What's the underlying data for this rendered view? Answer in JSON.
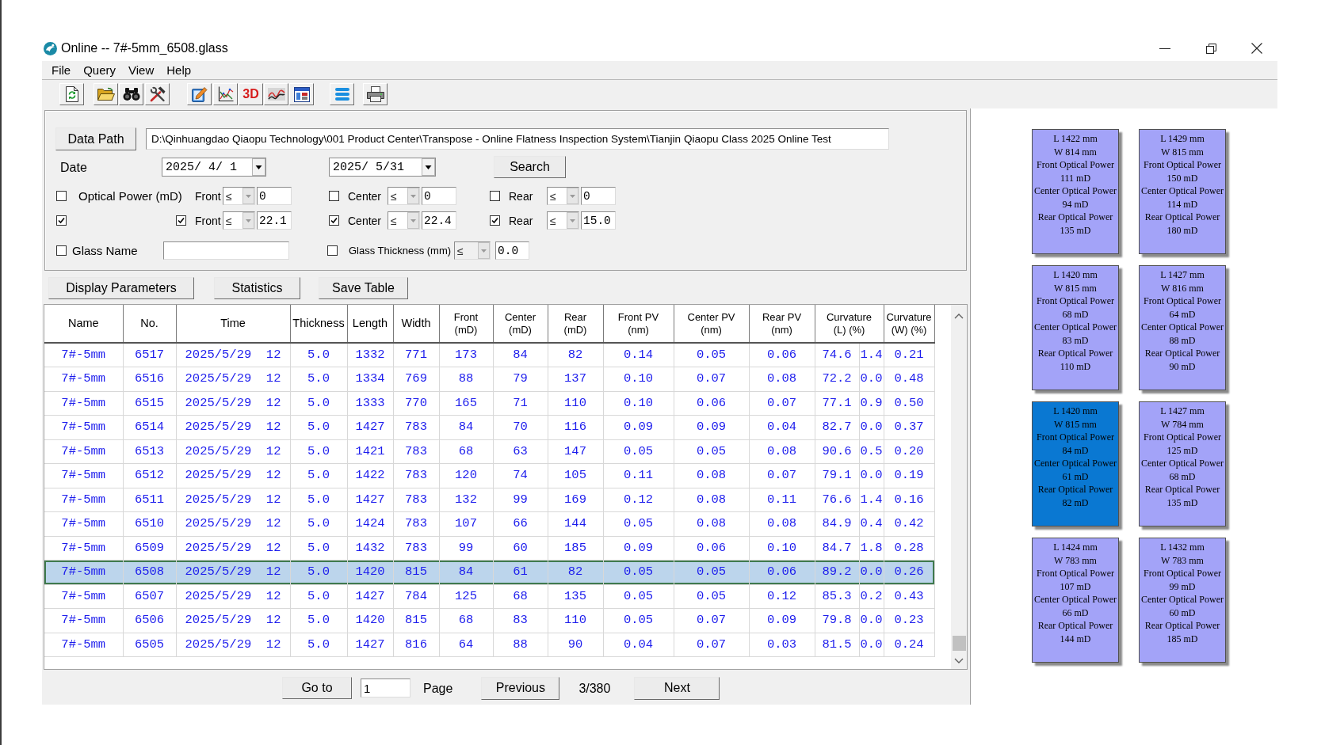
{
  "window": {
    "title": "Online -- 7#-5mm_6508.glass"
  },
  "menu": [
    "File",
    "Query",
    "View",
    "Help"
  ],
  "toolbar": {
    "text_button": "3D"
  },
  "filters": {
    "path_button": "Data Path",
    "path": "D:\\Qinhuangdao Qiaopu Technology\\001 Product Center\\Transpose - Online Flatness Inspection System\\Tianjin Qiaopu Class 2025 Online Test",
    "date_label": "Date",
    "date_from": "2025/ 4/ 1",
    "date_to": "2025/ 5/31",
    "search_button": "Search",
    "rows": [
      {
        "kind": "power",
        "checked": false,
        "label": "Optical Power (mD)",
        "conditions": [
          {
            "label": "Front",
            "operator": "≤",
            "value": "0"
          },
          {
            "checked": false,
            "label": "Center",
            "operator": "≤",
            "value": "0"
          },
          {
            "checked": false,
            "label": "Rear",
            "operator": "≤",
            "value": "0"
          }
        ]
      },
      {
        "kind": "power",
        "checked": true,
        "conditions": [
          {
            "checked": true,
            "label": "Front",
            "operator": "≤",
            "value": "22.1"
          },
          {
            "checked": true,
            "label": "Center",
            "operator": "≤",
            "value": "22.4"
          },
          {
            "checked": true,
            "label": "Rear",
            "operator": "≤",
            "value": "15.0"
          }
        ]
      },
      {
        "kind": "glass",
        "checked": false,
        "label": "Glass Name",
        "thickness": {
          "checked": false,
          "label": "Glass Thickness (mm)",
          "operator": "≤",
          "value": "0.0"
        }
      }
    ]
  },
  "actions": [
    "Display Parameters",
    "Statistics",
    "Save Table"
  ],
  "table": {
    "columns": [
      {
        "label": "Name"
      },
      {
        "label": "No."
      },
      {
        "label": "Time"
      },
      {
        "label": "Thickness"
      },
      {
        "label": "Length"
      },
      {
        "label": "Width"
      },
      {
        "label": "Front\n(mD)"
      },
      {
        "label": "Center\n(mD)"
      },
      {
        "label": "Rear\n(mD)"
      },
      {
        "label": "Front PV\n(nm)"
      },
      {
        "label": "Center PV\n(nm)"
      },
      {
        "label": "Rear PV\n(nm)"
      },
      {
        "label": "Curvature\n(L) (%)",
        "colspan": 2
      },
      {
        "label": "Curvature\n(W) (%)"
      }
    ],
    "rows": [
      {
        "selected": false,
        "cells": [
          "7#-5mm",
          "6517",
          "2025/5/29  12",
          "5.0",
          "1332",
          "771",
          "173",
          "84",
          "82",
          "0.14",
          "0.05",
          "0.06",
          "74.6",
          "1.4",
          "0.21"
        ]
      },
      {
        "selected": false,
        "cells": [
          "7#-5mm",
          "6516",
          "2025/5/29  12",
          "5.0",
          "1334",
          "769",
          "88",
          "79",
          "137",
          "0.10",
          "0.07",
          "0.08",
          "72.2",
          "0.0",
          "0.48"
        ]
      },
      {
        "selected": false,
        "cells": [
          "7#-5mm",
          "6515",
          "2025/5/29  12",
          "5.0",
          "1333",
          "770",
          "165",
          "71",
          "110",
          "0.10",
          "0.06",
          "0.07",
          "77.1",
          "0.9",
          "0.50"
        ]
      },
      {
        "selected": false,
        "cells": [
          "7#-5mm",
          "6514",
          "2025/5/29  12",
          "5.0",
          "1427",
          "783",
          "84",
          "70",
          "116",
          "0.09",
          "0.09",
          "0.04",
          "82.7",
          "0.0",
          "0.37"
        ]
      },
      {
        "selected": false,
        "cells": [
          "7#-5mm",
          "6513",
          "2025/5/29  12",
          "5.0",
          "1421",
          "783",
          "68",
          "63",
          "147",
          "0.05",
          "0.05",
          "0.08",
          "90.6",
          "0.5",
          "0.20"
        ]
      },
      {
        "selected": false,
        "cells": [
          "7#-5mm",
          "6512",
          "2025/5/29  12",
          "5.0",
          "1422",
          "783",
          "120",
          "74",
          "105",
          "0.11",
          "0.08",
          "0.07",
          "79.1",
          "0.0",
          "0.19"
        ]
      },
      {
        "selected": false,
        "cells": [
          "7#-5mm",
          "6511",
          "2025/5/29  12",
          "5.0",
          "1427",
          "783",
          "132",
          "99",
          "169",
          "0.12",
          "0.08",
          "0.11",
          "76.6",
          "1.4",
          "0.16"
        ]
      },
      {
        "selected": false,
        "cells": [
          "7#-5mm",
          "6510",
          "2025/5/29  12",
          "5.0",
          "1424",
          "783",
          "107",
          "66",
          "144",
          "0.05",
          "0.08",
          "0.08",
          "84.9",
          "0.4",
          "0.42"
        ]
      },
      {
        "selected": false,
        "cells": [
          "7#-5mm",
          "6509",
          "2025/5/29  12",
          "5.0",
          "1432",
          "783",
          "99",
          "60",
          "185",
          "0.09",
          "0.06",
          "0.10",
          "84.7",
          "1.8",
          "0.28"
        ]
      },
      {
        "selected": true,
        "cells": [
          "7#-5mm",
          "6508",
          "2025/5/29  12",
          "5.0",
          "1420",
          "815",
          "84",
          "61",
          "82",
          "0.05",
          "0.05",
          "0.06",
          "89.2",
          "0.0",
          "0.26"
        ]
      },
      {
        "selected": false,
        "cells": [
          "7#-5mm",
          "6507",
          "2025/5/29  12",
          "5.0",
          "1427",
          "784",
          "125",
          "68",
          "135",
          "0.05",
          "0.05",
          "0.12",
          "85.3",
          "0.2",
          "0.43"
        ]
      },
      {
        "selected": false,
        "cells": [
          "7#-5mm",
          "6506",
          "2025/5/29  12",
          "5.0",
          "1420",
          "815",
          "68",
          "83",
          "110",
          "0.05",
          "0.07",
          "0.09",
          "79.8",
          "0.0",
          "0.23"
        ]
      },
      {
        "selected": false,
        "cells": [
          "7#-5mm",
          "6505",
          "2025/5/29  12",
          "5.0",
          "1427",
          "816",
          "64",
          "88",
          "90",
          "0.04",
          "0.07",
          "0.03",
          "81.5",
          "0.0",
          "0.24"
        ]
      }
    ]
  },
  "pager": {
    "goto_button": "Go to",
    "page": "1",
    "page_label": "Page",
    "previous_button": "Previous",
    "position": "3/380",
    "next_button": "Next"
  },
  "cards": [
    {
      "length": "L 1422 mm",
      "width": "W 814 mm",
      "front_label": "Front Optical Power",
      "front": "111 mD",
      "center_label": "Center Optical Power",
      "center": "94 mD",
      "rear_label": "Rear Optical Power",
      "rear": "135 mD",
      "selected": false
    },
    {
      "length": "L 1429 mm",
      "width": "W 815 mm",
      "front_label": "Front Optical Power",
      "front": "150 mD",
      "center_label": "Center Optical Power",
      "center": "114 mD",
      "rear_label": "Rear Optical Power",
      "rear": "180 mD",
      "selected": false
    },
    {
      "length": "L 1420 mm",
      "width": "W 815 mm",
      "front_label": "Front Optical Power",
      "front": "68 mD",
      "center_label": "Center Optical Power",
      "center": "83 mD",
      "rear_label": "Rear Optical Power",
      "rear": "110 mD",
      "selected": false
    },
    {
      "length": "L 1427 mm",
      "width": "W 816 mm",
      "front_label": "Front Optical Power",
      "front": "64 mD",
      "center_label": "Center Optical Power",
      "center": "88 mD",
      "rear_label": "Rear Optical Power",
      "rear": "90 mD",
      "selected": false
    },
    {
      "length": "L 1420 mm",
      "width": "W 815 mm",
      "front_label": "Front Optical Power",
      "front": "84 mD",
      "center_label": "Center Optical Power",
      "center": "61 mD",
      "rear_label": "Rear Optical Power",
      "rear": "82 mD",
      "selected": true
    },
    {
      "length": "L 1427 mm",
      "width": "W 784 mm",
      "front_label": "Front Optical Power",
      "front": "125 mD",
      "center_label": "Center Optical Power",
      "center": "68 mD",
      "rear_label": "Rear Optical Power",
      "rear": "135 mD",
      "selected": false
    },
    {
      "length": "L 1424 mm",
      "width": "W 783 mm",
      "front_label": "Front Optical Power",
      "front": "107 mD",
      "center_label": "Center Optical Power",
      "center": "66 mD",
      "rear_label": "Rear Optical Power",
      "rear": "144 mD",
      "selected": false
    },
    {
      "length": "L 1432 mm",
      "width": "W 783 mm",
      "front_label": "Front Optical Power",
      "front": "99 mD",
      "center_label": "Center Optical Power",
      "center": "60 mD",
      "rear_label": "Rear Optical Power",
      "rear": "185 mD",
      "selected": false
    }
  ]
}
